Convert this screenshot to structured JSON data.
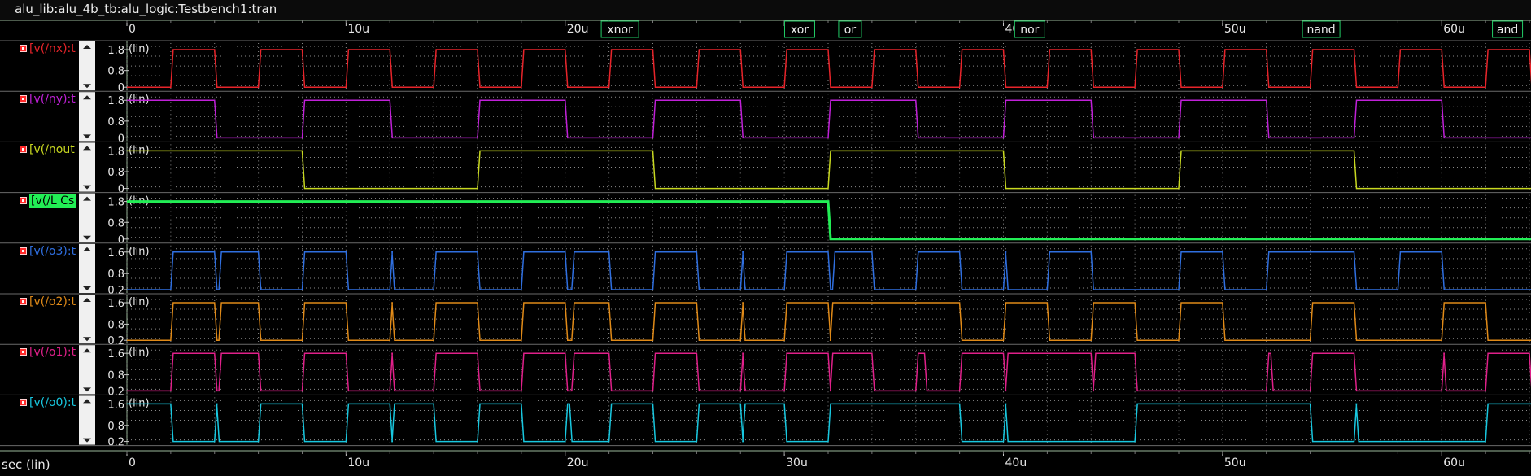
{
  "window": {
    "title": "alu_lib:alu_4b_tb:alu_logic:Testbench1:tran"
  },
  "xaxis_caption": "sec (lin)",
  "mode_labels": [
    {
      "label": "xnor",
      "x": 22.5
    },
    {
      "label": "xor",
      "x": 30.7
    },
    {
      "label": "or",
      "x": 33.0
    },
    {
      "label": "nor",
      "x": 41.2
    },
    {
      "label": "nand",
      "x": 54.5
    },
    {
      "label": "and",
      "x": 63.0
    }
  ],
  "colors": {
    "background": "#000000",
    "grid": "#888888",
    "axis": "#9ab89a",
    "label_text": "#ff2a2a"
  },
  "chart_data": {
    "type": "line",
    "title": "",
    "xlabel": "sec (lin)",
    "x_unit": "u",
    "xlim": [
      0,
      64
    ],
    "x_ticks": [
      0,
      10,
      20,
      30,
      40,
      50,
      60
    ],
    "x_tick_labels": [
      "0",
      "10u",
      "20u",
      "30u",
      "40u",
      "50u",
      "60u"
    ],
    "grid": true,
    "series": [
      {
        "name": "v(/nx)",
        "label": "[v(/nx):t",
        "color": "#e8242a",
        "ylim": [
          0,
          1.8
        ],
        "ticks": [
          "1.8",
          "0.8",
          "0"
        ],
        "scale": "(lin)",
        "highlight": false,
        "transitions": [
          0,
          0,
          2,
          1.8,
          4,
          0,
          6,
          1.8,
          8,
          0,
          10,
          1.8,
          12,
          0,
          14,
          1.8,
          16,
          0,
          18,
          1.8,
          20,
          0,
          22,
          1.8,
          24,
          0,
          26,
          1.8,
          28,
          0,
          30,
          1.8,
          32,
          0,
          34,
          1.8,
          36,
          0,
          38,
          1.8,
          40,
          0,
          42,
          1.8,
          44,
          0,
          46,
          1.8,
          48,
          0,
          50,
          1.8,
          52,
          0,
          54,
          1.8,
          56,
          0,
          58,
          1.8,
          60,
          0,
          62,
          1.8,
          64,
          0
        ]
      },
      {
        "name": "v(/ny)",
        "label": "[v(/ny):t",
        "color": "#c020d8",
        "ylim": [
          0,
          1.8
        ],
        "ticks": [
          "1.8",
          "0.8",
          "0"
        ],
        "scale": "(lin)",
        "highlight": false,
        "transitions": [
          0,
          1.8,
          4,
          0,
          8,
          1.8,
          12,
          0,
          16,
          1.8,
          20,
          0,
          24,
          1.8,
          28,
          0,
          32,
          1.8,
          36,
          0,
          40,
          1.8,
          44,
          0,
          48,
          1.8,
          52,
          0,
          56,
          1.8,
          60,
          0,
          64,
          0
        ]
      },
      {
        "name": "v(/nout)",
        "label": "[v(/nout",
        "color": "#c8d820",
        "ylim": [
          0,
          1.8
        ],
        "ticks": [
          "1.8",
          "0.8",
          "0"
        ],
        "scale": "(lin)",
        "highlight": false,
        "transitions": [
          0,
          1.8,
          8,
          0,
          16,
          1.8,
          24,
          0,
          32,
          1.8,
          40,
          0,
          48,
          1.8,
          56,
          0,
          64,
          0
        ]
      },
      {
        "name": "v(/L_Cs)",
        "label": "[v(/L Cs",
        "color": "#22ee55",
        "ylim": [
          0,
          1.8
        ],
        "ticks": [
          "1.8",
          "0.8",
          "0"
        ],
        "scale": "(lin)",
        "highlight": true,
        "transitions": [
          0,
          1.8,
          32,
          0,
          64,
          0
        ]
      },
      {
        "name": "v(/o3)",
        "label": "[v(/o3):t",
        "color": "#2f6fe0",
        "ylim": [
          0.2,
          1.6
        ],
        "ticks": [
          "1.6",
          "0.8",
          "0.2"
        ],
        "scale": "(lin)",
        "highlight": false,
        "transitions": [
          0,
          0.2,
          2,
          1.6,
          4,
          0.2,
          4.2,
          1.6,
          6,
          0.2,
          8,
          1.6,
          10,
          0.2,
          12,
          1.6,
          12.1,
          0.2,
          14,
          1.6,
          16,
          0.2,
          18,
          1.6,
          20,
          0.2,
          20.3,
          1.6,
          22,
          0.2,
          24,
          1.6,
          26,
          0.2,
          28,
          1.6,
          28.1,
          0.2,
          30,
          1.6,
          32,
          0.2,
          32.2,
          1.6,
          34,
          0.2,
          36,
          1.6,
          38,
          0.2,
          40,
          1.6,
          40.1,
          0.2,
          42,
          1.6,
          44,
          0.2,
          48,
          1.6,
          50,
          0.2,
          52,
          1.6,
          56,
          0.2,
          58,
          1.6,
          60,
          0.2,
          64,
          0.2
        ]
      },
      {
        "name": "v(/o2)",
        "label": "[v(/o2):t",
        "color": "#e08a18",
        "ylim": [
          0.2,
          1.6
        ],
        "ticks": [
          "1.6",
          "0.8",
          "0.2"
        ],
        "scale": "(lin)",
        "highlight": false,
        "transitions": [
          0,
          0.2,
          2,
          1.6,
          4,
          0.2,
          4.2,
          1.6,
          6,
          0.2,
          8,
          1.6,
          10,
          0.2,
          12,
          1.6,
          12.1,
          0.2,
          14,
          1.6,
          16,
          0.2,
          18,
          1.6,
          20,
          0.2,
          20.3,
          1.6,
          22,
          0.2,
          24,
          1.6,
          26,
          0.2,
          28,
          1.6,
          28.1,
          0.2,
          30,
          1.6,
          32,
          0.2,
          32.1,
          1.6,
          38,
          0.2,
          40,
          1.6,
          42,
          0.2,
          44,
          1.6,
          46,
          0.2,
          48,
          1.6,
          50,
          0.2,
          54,
          1.6,
          56,
          0.2,
          60,
          1.6,
          62,
          0.2,
          64,
          0.2
        ]
      },
      {
        "name": "v(/o1)",
        "label": "[v(/o1):t",
        "color": "#e0208a",
        "ylim": [
          0.2,
          1.6
        ],
        "ticks": [
          "1.6",
          "0.8",
          "0.2"
        ],
        "scale": "(lin)",
        "highlight": false,
        "transitions": [
          0,
          0.2,
          2,
          1.6,
          4,
          0.2,
          4.2,
          1.6,
          6,
          0.2,
          8,
          1.6,
          10,
          0.2,
          12,
          1.6,
          12.1,
          0.2,
          14,
          1.6,
          16,
          0.2,
          18,
          1.6,
          20,
          0.2,
          20.3,
          1.6,
          22,
          0.2,
          24,
          1.6,
          26,
          0.2,
          28,
          1.6,
          28.1,
          0.2,
          30,
          1.6,
          32,
          0.2,
          32.1,
          1.6,
          34,
          0.2,
          36,
          1.6,
          36.4,
          0.2,
          38,
          1.6,
          40,
          0.2,
          40.1,
          1.6,
          44,
          0.2,
          44.1,
          1.6,
          46,
          0.2,
          52,
          1.6,
          52.2,
          0.2,
          54,
          1.6,
          56,
          0.2,
          60,
          1.6,
          60.1,
          0.2,
          62,
          1.6,
          64,
          0.2
        ]
      },
      {
        "name": "v(/o0)",
        "label": "[v(/o0):t",
        "color": "#18c8e0",
        "ylim": [
          0.2,
          1.6
        ],
        "ticks": [
          "1.6",
          "0.8",
          "0.2"
        ],
        "scale": "(lin)",
        "highlight": false,
        "transitions": [
          0,
          1.6,
          2,
          0.2,
          4,
          1.6,
          4.1,
          0.2,
          6,
          1.6,
          8,
          0.2,
          10,
          1.6,
          12,
          0.2,
          12.1,
          1.6,
          14,
          0.2,
          16,
          1.6,
          18,
          0.2,
          20,
          1.6,
          20.2,
          0.2,
          22,
          1.6,
          24,
          0.2,
          26,
          1.6,
          28,
          0.2,
          28.1,
          1.6,
          30,
          0.2,
          32,
          1.6,
          38,
          0.2,
          40,
          1.6,
          40.1,
          0.2,
          46,
          1.6,
          54,
          0.2,
          56,
          1.6,
          56.1,
          0.2,
          62,
          1.6,
          64,
          1.6
        ]
      }
    ]
  }
}
